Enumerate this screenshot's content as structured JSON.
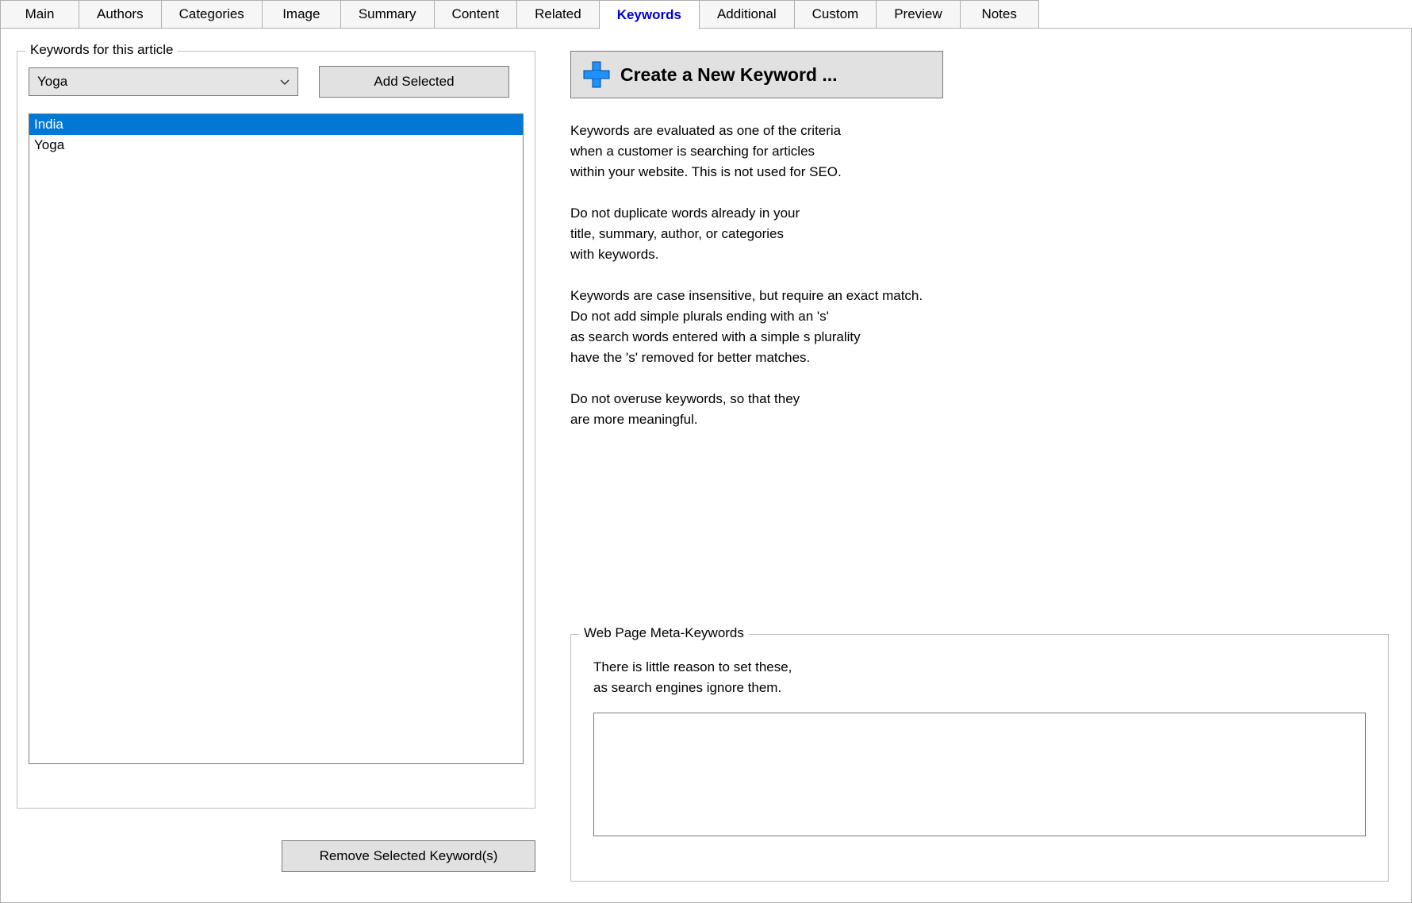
{
  "tabs": [
    {
      "label": "Main"
    },
    {
      "label": "Authors"
    },
    {
      "label": "Categories"
    },
    {
      "label": "Image"
    },
    {
      "label": "Summary"
    },
    {
      "label": "Content"
    },
    {
      "label": "Related"
    },
    {
      "label": "Keywords",
      "active": true
    },
    {
      "label": "Additional"
    },
    {
      "label": "Custom"
    },
    {
      "label": "Preview"
    },
    {
      "label": "Notes"
    }
  ],
  "keywords_group": {
    "legend": "Keywords for this article",
    "dropdown_selected": "Yoga",
    "add_button": "Add Selected",
    "list": [
      "India",
      "Yoga"
    ],
    "selected_index": 0,
    "remove_button": "Remove Selected Keyword(s)"
  },
  "create_button": "Create a New Keyword ...",
  "help_text": "Keywords are evaluated as one of the criteria\nwhen a customer is searching for articles\nwithin your website. This is not used for SEO.\n\nDo not duplicate words already in your\ntitle, summary, author, or categories\nwith keywords.\n\nKeywords are case insensitive, but require an exact match.\nDo not add simple plurals ending with an 's'\nas search words entered with a simple s plurality\nhave the 's' removed for better matches.\n\nDo not overuse keywords, so that they\nare more meaningful.",
  "meta_group": {
    "legend": "Web Page Meta-Keywords",
    "help": "There is little reason to set these,\nas search engines ignore them.",
    "value": ""
  }
}
